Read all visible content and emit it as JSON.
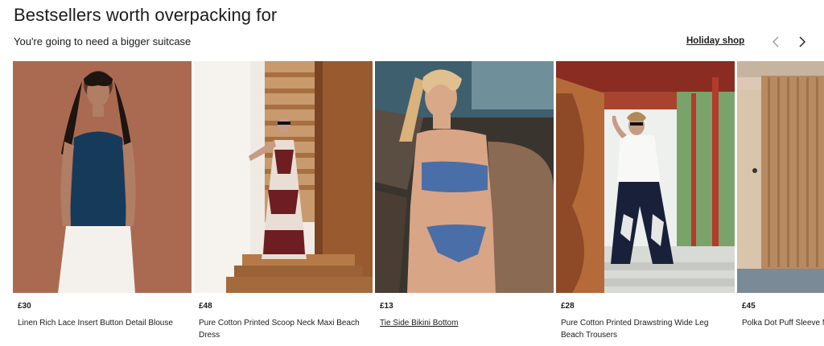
{
  "section": {
    "title": "Bestsellers worth overpacking for",
    "subtitle": "You're going to need a bigger suitcase",
    "link_label": "Holiday shop"
  },
  "carousel": {
    "prev_icon": "chevron-left-icon",
    "next_icon": "chevron-right-icon",
    "products": [
      {
        "price": "£30",
        "name": "Linen Rich Lace Insert Button Detail Blouse"
      },
      {
        "price": "£48",
        "name": "Pure Cotton Printed Scoop Neck Maxi Beach Dress"
      },
      {
        "price": "£13",
        "name": "Tie Side Bikini Bottom"
      },
      {
        "price": "£28",
        "name": "Pure Cotton Printed Drawstring Wide Leg Beach Trousers"
      },
      {
        "price": "£45",
        "name": "Polka Dot Puff Sleeve Midi"
      }
    ]
  }
}
